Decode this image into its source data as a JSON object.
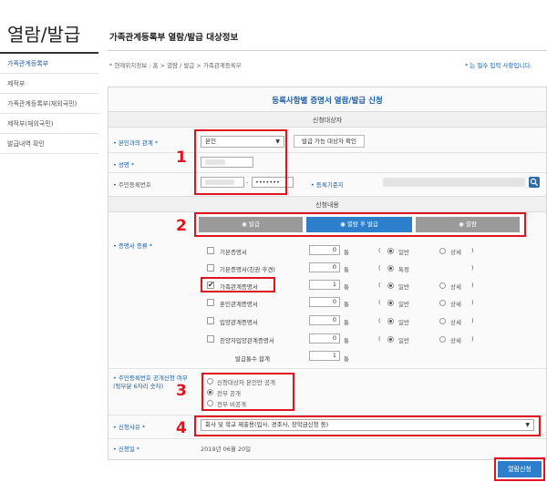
{
  "sidebar": {
    "title": "열람/발급",
    "items": [
      {
        "label": "가족관계등록부"
      },
      {
        "label": "제적부"
      },
      {
        "label": "가족관계등록부(재외국민)"
      },
      {
        "label": "제적부(재외국민)"
      },
      {
        "label": "발급내역 확인"
      }
    ]
  },
  "header": {
    "title": "가족관계등록부 열람/발급 대상정보",
    "breadcrumb": "* 현재위치정보 : 홈 > 열람 / 발급 > 가족관계등록부",
    "required_note": "* 는 필수 입력 사항입니다."
  },
  "form": {
    "title": "등록사항별 증명서 열람/발급 신청",
    "section_target": "신청대상자",
    "relation_label": "• 본인과의 관계 *",
    "relation_value": "본인",
    "check_target_button": "발급 가능 대상자 확인",
    "name_label": "• 성명 *",
    "rrn_label": "• 주민등록번호",
    "rrn_dash": "-",
    "rrn_masked": "•••••••",
    "reg_base_label": "• 등록기준지",
    "section_content": "신청내용",
    "cert_type_label": "• 증명서 종류 *",
    "modes": [
      {
        "label": "◉ 발급"
      },
      {
        "label": "◉ 열람 후 발급"
      },
      {
        "label": "◉ 열람"
      }
    ],
    "certificates": [
      {
        "name": "기본증명서",
        "count": "0",
        "unit": "통",
        "opt": "일반",
        "opt2": "상세"
      },
      {
        "name": "기본증명서(친권·후견)",
        "count": "0",
        "unit": "통",
        "opt": "특정",
        "opt2": ""
      },
      {
        "name": "가족관계증명서",
        "count": "1",
        "unit": "통",
        "opt": "일반",
        "opt2": "상세"
      },
      {
        "name": "혼인관계증명서",
        "count": "0",
        "unit": "통",
        "opt": "일반",
        "opt2": "상세"
      },
      {
        "name": "입양관계증명서",
        "count": "0",
        "unit": "통",
        "opt": "일반",
        "opt2": "상세"
      },
      {
        "name": "친양자입양관계증명서",
        "count": "0",
        "unit": "통",
        "opt": "일반",
        "opt2": "상세"
      }
    ],
    "total_label": "발급통수 합계",
    "total_value": "1",
    "total_unit": "통",
    "rrn_disclose_label": "• 주민등록번호 공개신청 여부 (뒷부분 6자리 숫자)",
    "rrn_disclose_options": [
      {
        "label": "신청대상자 본인만 공개"
      },
      {
        "label": "전부 공개"
      },
      {
        "label": "전부 비공개"
      }
    ],
    "reason_label": "• 신청사유 *",
    "reason_value": "회사 및 학교 제출용(입사, 경조사, 장학금신청 등)",
    "date_label": "• 신청일 *",
    "date_value": "2019년 06월 20일",
    "submit_label": "열람신청"
  },
  "markers": [
    "1",
    "2",
    "3",
    "4"
  ],
  "colors": {
    "accent": "#2e7fcb",
    "highlight": "#e0141e"
  }
}
